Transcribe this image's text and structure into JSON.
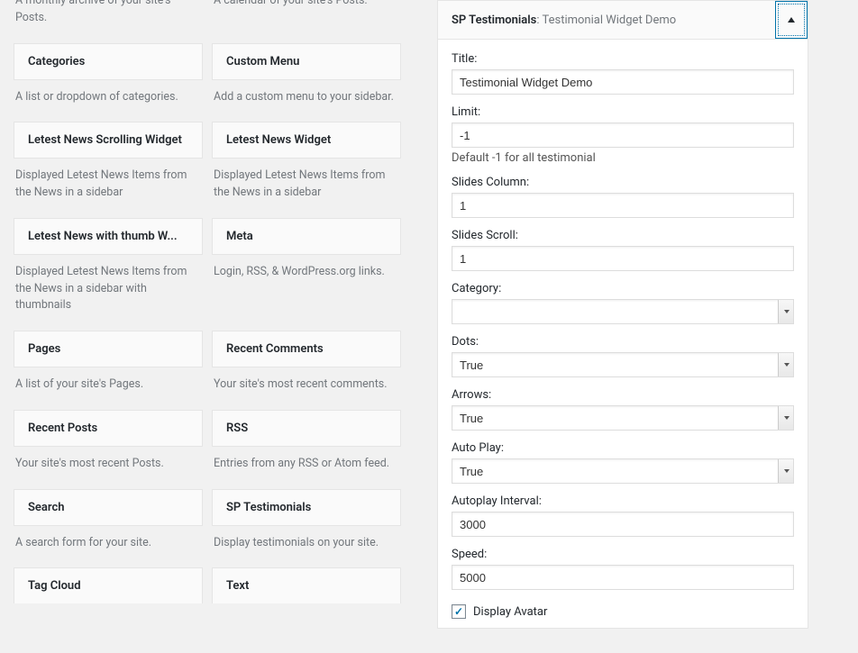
{
  "available_widgets": [
    {
      "title": "",
      "desc": "A monthly archive of your site's Posts."
    },
    {
      "title": "",
      "desc": "A calendar of your site's Posts."
    },
    {
      "title": "Categories",
      "desc": "A list or dropdown of categories."
    },
    {
      "title": "Custom Menu",
      "desc": "Add a custom menu to your sidebar."
    },
    {
      "title": "Letest News Scrolling Widget",
      "desc": "Displayed Letest News Items from the News in a sidebar"
    },
    {
      "title": "Letest News Widget",
      "desc": "Displayed Letest News Items from the News in a sidebar"
    },
    {
      "title": "Letest News with thumb W...",
      "desc": "Displayed Letest News Items from the News in a sidebar with thumbnails"
    },
    {
      "title": "Meta",
      "desc": "Login, RSS, & WordPress.org links."
    },
    {
      "title": "Pages",
      "desc": "A list of your site's Pages."
    },
    {
      "title": "Recent Comments",
      "desc": "Your site's most recent comments."
    },
    {
      "title": "Recent Posts",
      "desc": "Your site's most recent Posts."
    },
    {
      "title": "RSS",
      "desc": "Entries from any RSS or Atom feed."
    },
    {
      "title": "Search",
      "desc": "A search form for your site."
    },
    {
      "title": "SP Testimonials",
      "desc": "Display testimonials on your site."
    },
    {
      "title": "Tag Cloud",
      "desc": ""
    },
    {
      "title": "Text",
      "desc": ""
    }
  ],
  "widget_panel": {
    "name": "SP Testimonials",
    "subtitle": "Testimonial Widget Demo",
    "fields": {
      "title_label": "Title:",
      "title_value": "Testimonial Widget Demo",
      "limit_label": "Limit:",
      "limit_value": "-1",
      "limit_help": "Default -1 for all testimonial",
      "slides_column_label": "Slides Column:",
      "slides_column_value": "1",
      "slides_scroll_label": "Slides Scroll:",
      "slides_scroll_value": "1",
      "category_label": "Category:",
      "category_value": "",
      "dots_label": "Dots:",
      "dots_value": "True",
      "arrows_label": "Arrows:",
      "arrows_value": "True",
      "autoplay_label": "Auto Play:",
      "autoplay_value": "True",
      "autoplay_interval_label": "Autoplay Interval:",
      "autoplay_interval_value": "3000",
      "speed_label": "Speed:",
      "speed_value": "5000",
      "display_avatar_label": "Display Avatar",
      "display_avatar_checked": true
    }
  }
}
